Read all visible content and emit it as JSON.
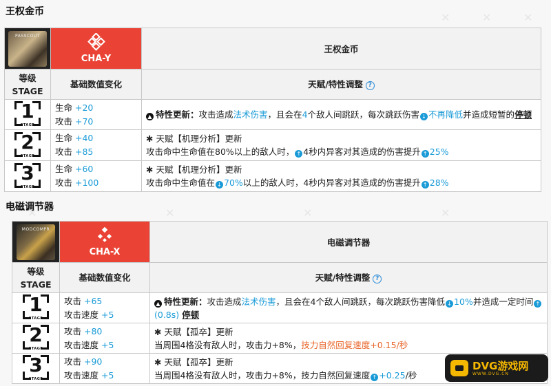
{
  "sections": [
    {
      "title": "王权金币",
      "code": "CHA-Y",
      "name": "王权金币",
      "header_level": "等级",
      "header_stage": "STAGE",
      "header_stats": "基础数值变化",
      "header_talent": "天赋/特性调整",
      "rows": [
        {
          "stage": "1",
          "stat1_label": "生命",
          "stat1_value": "+20",
          "stat2_label": "攻击",
          "stat2_value": "+70"
        },
        {
          "stage": "2",
          "stat1_label": "生命",
          "stat1_value": "+40",
          "stat2_label": "攻击",
          "stat2_value": "+85"
        },
        {
          "stage": "3",
          "stat1_label": "生命",
          "stat1_value": "+60",
          "stat2_label": "攻击",
          "stat2_value": "+100"
        }
      ],
      "descs": {
        "r1": {
          "prefix": "特性更新：",
          "t1": "攻击造成",
          "t2": "法术伤害",
          "t3": "，且会在",
          "t4": "4",
          "t5": "个敌人间跳跃，每次跳跃伤害",
          "t6": "不再降低",
          "t7": "并造成短暂的",
          "t8": "停顿"
        },
        "r2": {
          "l1": "天赋【机理分析】更新",
          "t1": "攻击命中生命值在80%以上的敌人时，",
          "t2": "4秒内异客对其造成的伤害提升",
          "t3": "25%"
        },
        "r3": {
          "l1": "天赋【机理分析】更新",
          "t1": "攻击命中生命值在",
          "t2": "70%",
          "t3": "以上的敌人时，4秒内异客对其造成的伤害提升",
          "t4": "28%"
        }
      }
    },
    {
      "title": "电磁调节器",
      "code": "CHA-X",
      "name": "电磁调节器",
      "header_level": "等级",
      "header_stage": "STAGE",
      "header_stats": "基础数值变化",
      "header_talent": "天赋/特性调整",
      "rows": [
        {
          "stage": "1",
          "stat1_label": "攻击",
          "stat1_value": "+65",
          "stat2_label": "攻击速度",
          "stat2_value": "+5"
        },
        {
          "stage": "2",
          "stat1_label": "攻击",
          "stat1_value": "+80",
          "stat2_label": "攻击速度",
          "stat2_value": "+5"
        },
        {
          "stage": "3",
          "stat1_label": "攻击",
          "stat1_value": "+90",
          "stat2_label": "攻击速度",
          "stat2_value": "+5"
        }
      ],
      "descs": {
        "r1": {
          "prefix": "特性更新：",
          "t1": "攻击造成",
          "t2": "法术伤害",
          "t3": "，且会在4个敌人间跳跃，每次跳跃伤害降低",
          "t4": "10%",
          "t5": "并造成一定时间",
          "t6": "(0.8s)",
          "t7": "停顿"
        },
        "r2": {
          "l1": "天赋【孤卒】更新",
          "t1": "当周围4格没有敌人时，攻击力+8%，",
          "t2": "技力自然回复速度+0.15/秒"
        },
        "r3": {
          "l1": "天赋【孤卒】更新",
          "t1": "当周围4格没有敌人时，攻击力+8%，技力自然回复速度",
          "t2": "+0.25",
          "t3": "/秒"
        }
      }
    }
  ],
  "stage_word": "STAGE",
  "watermark": {
    "name": "DVG游戏网",
    "url": "WWW.DVG.CN"
  },
  "colors": {
    "accent": "#ea4335",
    "link": "#1a9bd7",
    "orange": "#e8662a",
    "logo": "#f5b800"
  },
  "icons": [
    "help-icon",
    "arrow-down-icon",
    "arrow-up-icon",
    "asterisk-icon",
    "caret-up-icon",
    "gamepad-icon"
  ]
}
